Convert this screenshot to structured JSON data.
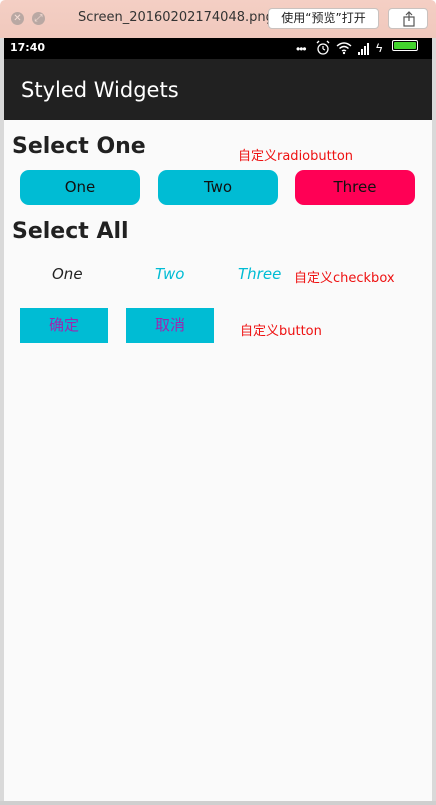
{
  "window": {
    "filename": "Screen_20160202174048.png",
    "open_with_label": "使用“预览”打开"
  },
  "status_bar": {
    "time": "17:40",
    "icons": [
      "more-icon",
      "alarm-icon",
      "wifi-icon",
      "signal-icon",
      "charging-icon",
      "battery-icon"
    ],
    "battery_color": "#43d42e"
  },
  "app_bar": {
    "title": "Styled Widgets",
    "color": "#212121"
  },
  "select_one": {
    "heading": "Select One",
    "note": "自定义radiobutton",
    "options": [
      {
        "label": "One",
        "checked": false
      },
      {
        "label": "Two",
        "checked": false
      },
      {
        "label": "Three",
        "checked": true
      }
    ],
    "color_unchecked": "#00bcd4",
    "color_checked": "#ff0055"
  },
  "select_all": {
    "heading": "Select All",
    "note": "自定义checkbox",
    "options": [
      {
        "label": "One",
        "checked": false
      },
      {
        "label": "Two",
        "checked": true
      },
      {
        "label": "Three",
        "checked": true
      }
    ]
  },
  "buttons": {
    "confirm_label": "确定",
    "cancel_label": "取消",
    "note": "自定义button",
    "background": "#00bcd4",
    "text_color": "#9c27b0"
  }
}
